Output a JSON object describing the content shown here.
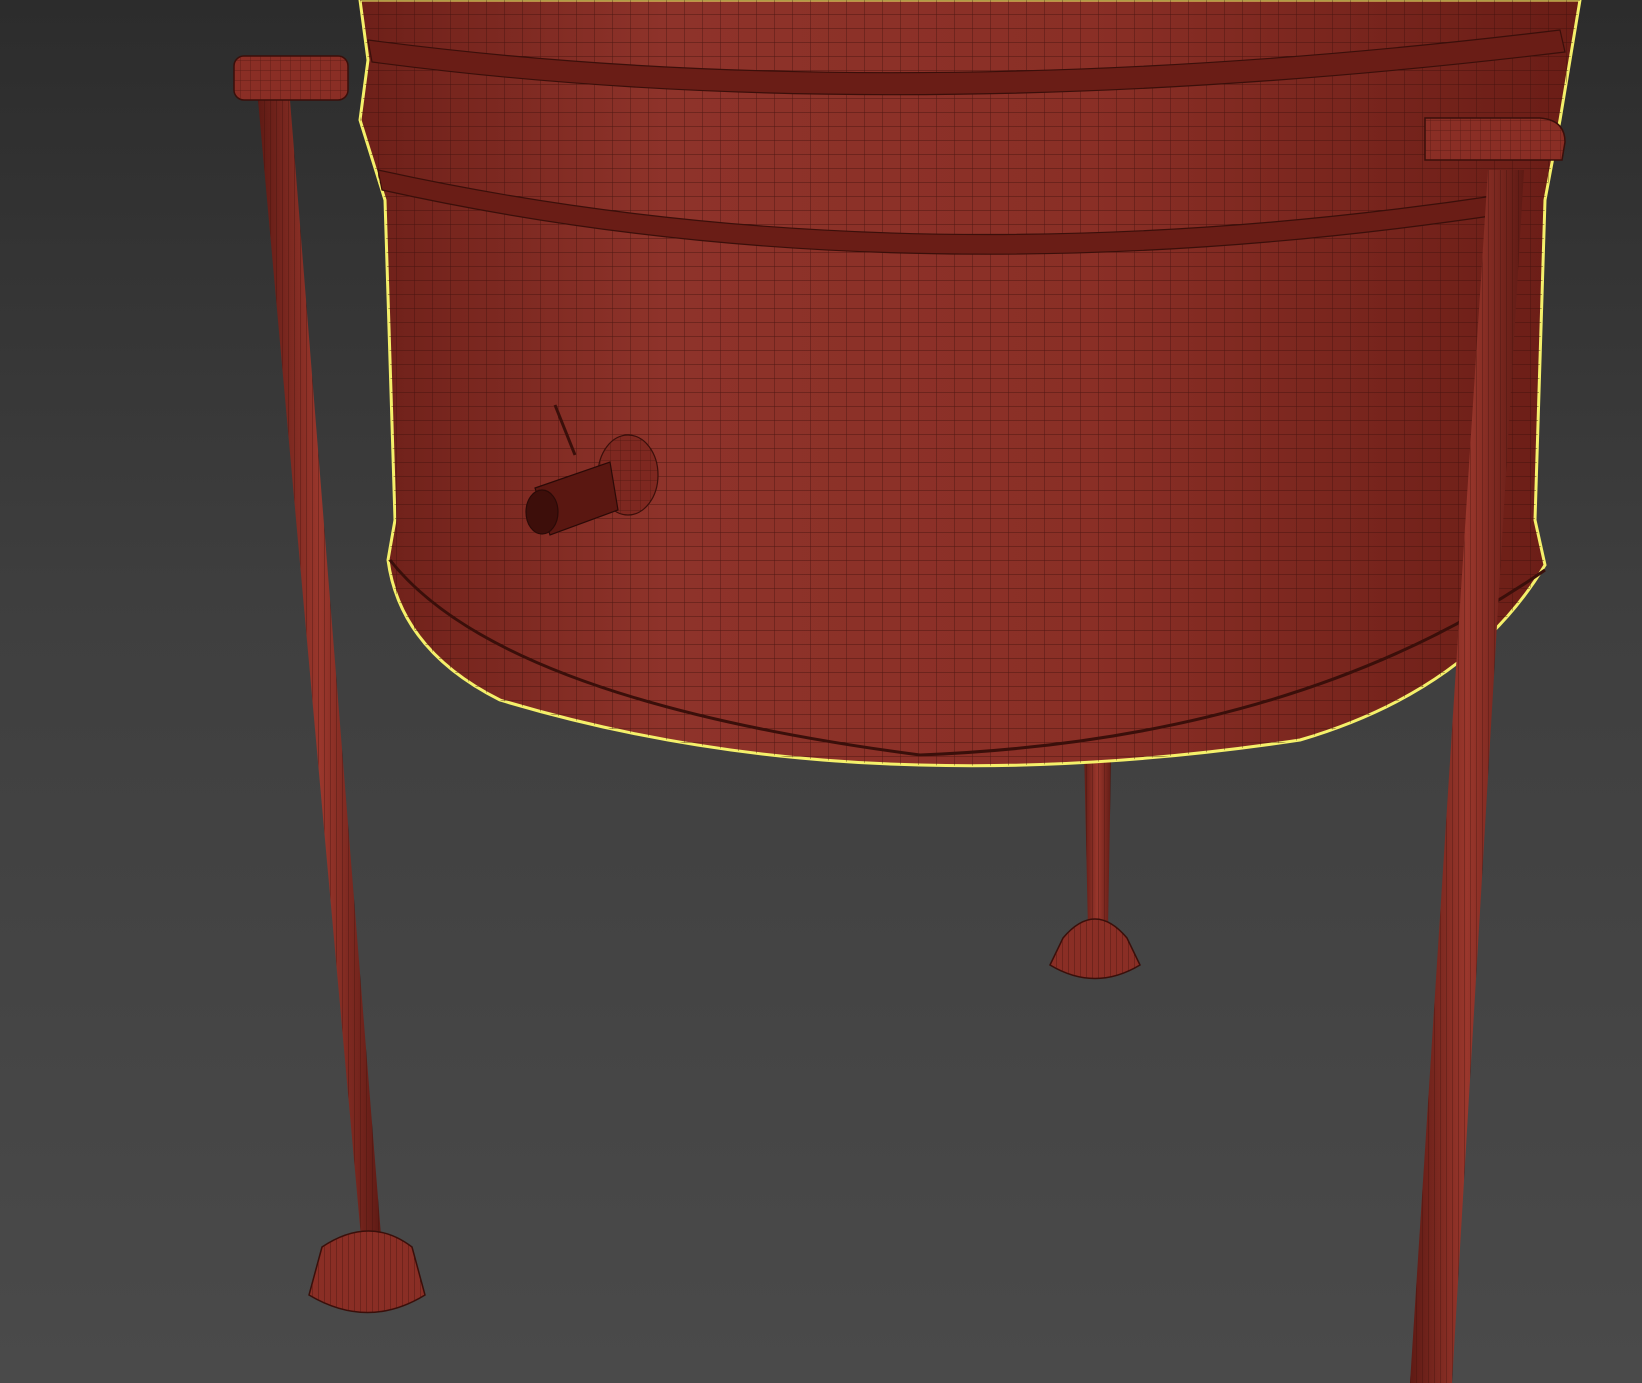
{
  "viewport": {
    "name": "3D viewport",
    "shading": "wireframe-over-shaded",
    "object_color": "#8a2e25",
    "wire_color": "#3a0f0a",
    "selection_outline_color": "#f5f06a",
    "background_top": "#2c2c2c",
    "background_bottom": "#4a4a4a"
  },
  "scene": {
    "object": "tank-on-stand",
    "parts": [
      "tank-body",
      "tank-rim-band",
      "drain-valve",
      "leg-left",
      "leg-back",
      "leg-right",
      "foot-left",
      "foot-back"
    ]
  }
}
